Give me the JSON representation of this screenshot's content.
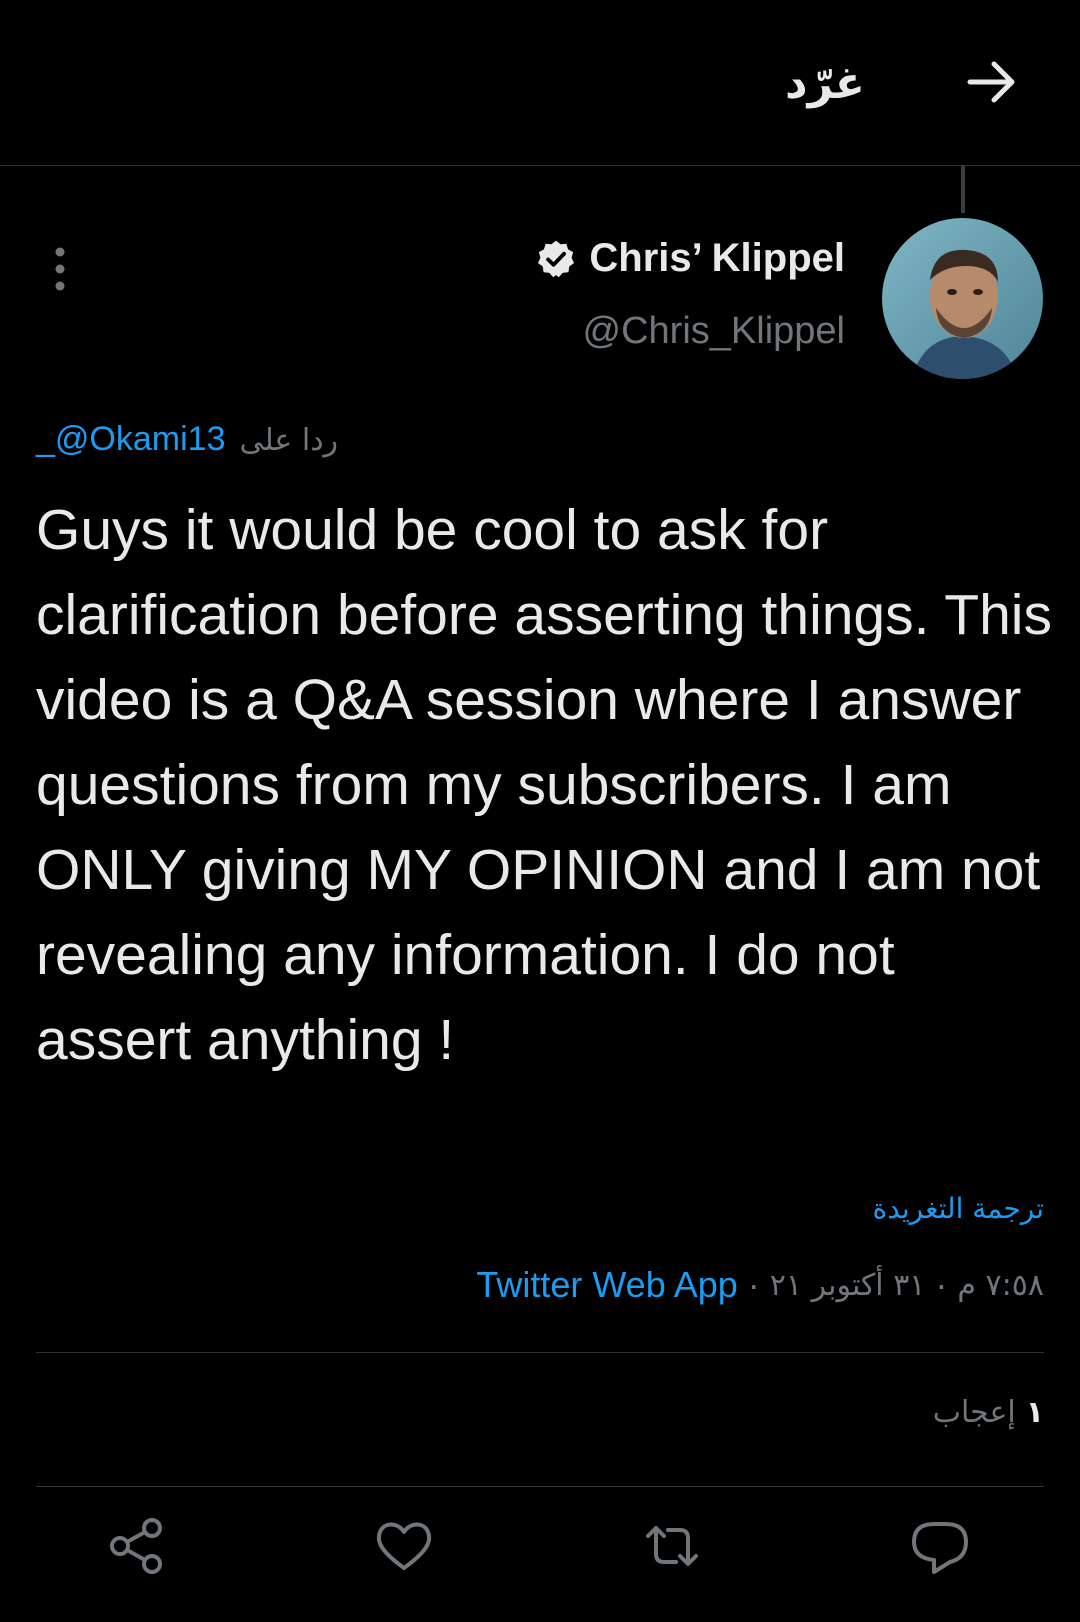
{
  "header": {
    "title": "غرّد",
    "back_icon": "arrow-right-icon"
  },
  "author": {
    "display_name": "Chris’ Klippel",
    "handle": "@Chris_Klippel",
    "verified_icon": "verified-badge-icon"
  },
  "reply": {
    "label": "ردا على",
    "mention": "_@Okami13"
  },
  "tweet": {
    "text": "Guys it would be cool to ask for clarification before asserting things. This video is a Q&A session where I answer questions from my subscribers. I am ONLY giving MY OPINION and I am not revealing any information. I do not assert anything !",
    "translate_label": "ترجمة التغريدة"
  },
  "meta": {
    "time": "٧:٥٨ م",
    "date": "٣١ أكتوبر ٢١",
    "separator": "·",
    "source": "Twitter Web App"
  },
  "stats": {
    "likes_count": "١",
    "likes_label": "إعجاب"
  },
  "actions": {
    "share_icon": "share-icon",
    "like_icon": "heart-icon",
    "retweet_icon": "retweet-icon",
    "reply_icon": "reply-icon"
  },
  "colors": {
    "background": "#000000",
    "text": "#e7e9ea",
    "muted": "#71767b",
    "link": "#1d9bf0",
    "divider": "#2f3336"
  }
}
